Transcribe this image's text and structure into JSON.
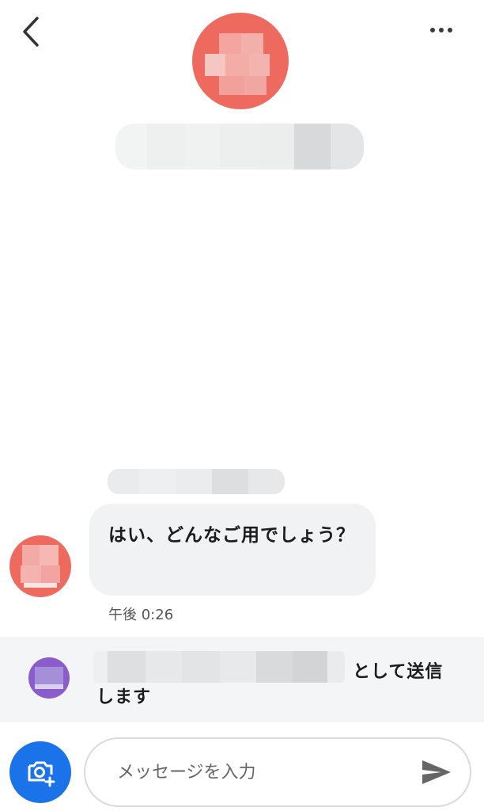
{
  "header": {
    "back_icon": "chevron-left-icon",
    "more_icon": "more-horizontal-icon",
    "avatar_color": "#ee6a5e"
  },
  "messages": [
    {
      "text": "はい、どんなご用でしょう？",
      "time": "午後 0:26",
      "bubble_color": "#f1f2f4",
      "avatar_color": "#ee6a5e"
    }
  ],
  "sender_bar": {
    "suffix_text": "として送信",
    "line2_text": "します",
    "avatar_color": "#8a5ccc"
  },
  "composer": {
    "placeholder": "メッセージを入力",
    "camera_icon": "add-photo-icon",
    "send_icon": "send-icon",
    "accent": "#1a73e8"
  }
}
